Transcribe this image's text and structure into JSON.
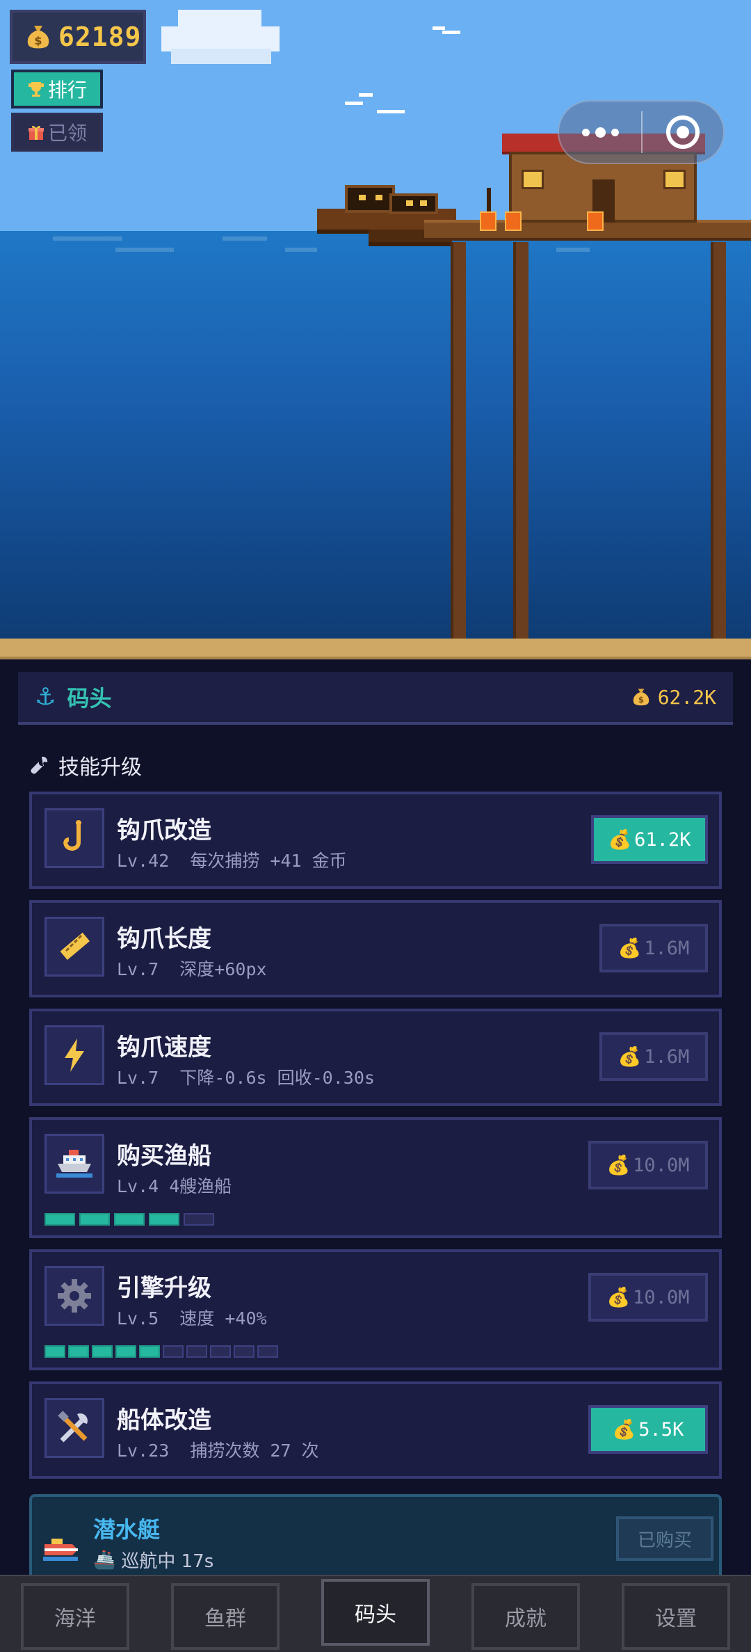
{
  "hud": {
    "coins": "62189",
    "rank_label": "排行",
    "gift_label": "已领"
  },
  "header": {
    "title": "码头",
    "coins": "62.2K"
  },
  "section": {
    "title": "技能升级"
  },
  "upgrades": [
    {
      "name": "钩爪改造",
      "desc": "Lv.42  每次捕捞 +41 金币",
      "price": "61.2K",
      "affordable": true,
      "icon": "hook-icon"
    },
    {
      "name": "钩爪长度",
      "desc": "Lv.7  深度+60px",
      "price": "1.6M",
      "affordable": false,
      "icon": "ruler-icon"
    },
    {
      "name": "钩爪速度",
      "desc": "Lv.7  下降-0.6s 回收-0.30s",
      "price": "1.6M",
      "affordable": false,
      "icon": "lightning-icon"
    },
    {
      "name": "购买渔船",
      "desc": "Lv.4 4艘渔船",
      "price": "10.0M",
      "affordable": false,
      "icon": "ship-icon",
      "progress": {
        "filled": 4,
        "total": 5
      }
    },
    {
      "name": "引擎升级",
      "desc": "Lv.5  速度 +40%",
      "price": "10.0M",
      "affordable": false,
      "icon": "gear-icon",
      "progress": {
        "filled": 5,
        "total": 10
      }
    },
    {
      "name": "船体改造",
      "desc": "Lv.23  捕捞次数 27 次",
      "price": "5.5K",
      "affordable": true,
      "icon": "tools-icon"
    }
  ],
  "submarine": {
    "name": "潜水艇",
    "status": "巡航中 17s",
    "button": "已购买"
  },
  "nav": {
    "tabs": [
      "海洋",
      "鱼群",
      "码头",
      "成就",
      "设置"
    ],
    "active": 2
  },
  "colors": {
    "accent": "#26b7a0",
    "gold": "#f4c64a",
    "panel": "#1c1d42",
    "sky": "#6ab0f2",
    "sea": "#1a5fae"
  }
}
